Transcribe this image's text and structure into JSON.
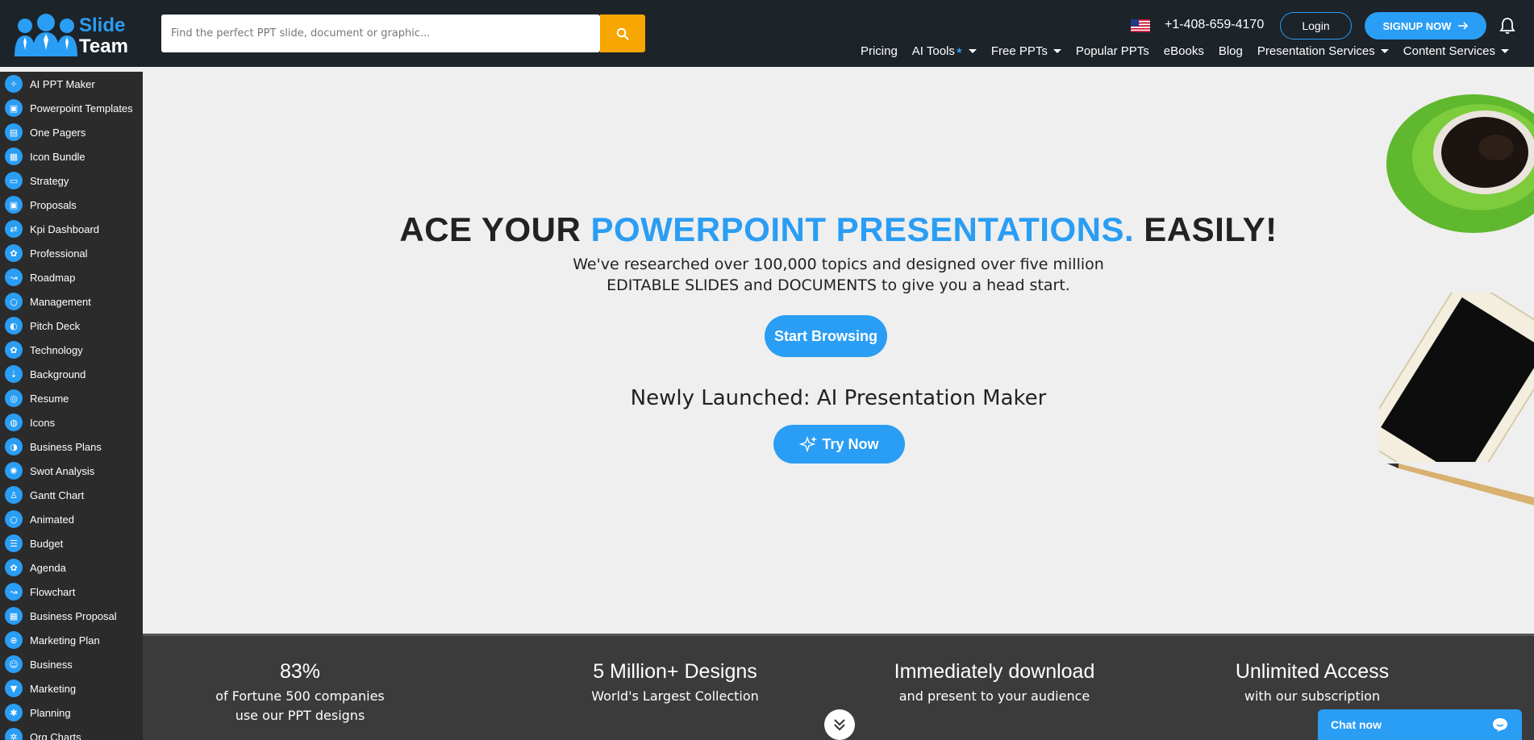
{
  "header": {
    "logo": {
      "line1": "Slide",
      "line2": "Team"
    },
    "search": {
      "placeholder": "Find the perfect PPT slide, document or graphic..."
    },
    "phone": "+1-408-659-4170",
    "login_label": "Login",
    "signup_label": "SIGNUP NOW",
    "nav": [
      {
        "label": "Pricing",
        "dropdown": false
      },
      {
        "label": "AI Tools",
        "dropdown": true,
        "star": true
      },
      {
        "label": "Free PPTs",
        "dropdown": true
      },
      {
        "label": "Popular PPTs",
        "dropdown": false
      },
      {
        "label": "eBooks",
        "dropdown": false
      },
      {
        "label": "Blog",
        "dropdown": false
      },
      {
        "label": "Presentation Services",
        "dropdown": true
      },
      {
        "label": "Content Services",
        "dropdown": true
      }
    ]
  },
  "sidebar": {
    "items": [
      {
        "label": "AI PPT Maker"
      },
      {
        "label": "Powerpoint Templates"
      },
      {
        "label": "One Pagers"
      },
      {
        "label": "Icon Bundle"
      },
      {
        "label": "Strategy"
      },
      {
        "label": "Proposals"
      },
      {
        "label": "Kpi Dashboard"
      },
      {
        "label": "Professional"
      },
      {
        "label": "Roadmap"
      },
      {
        "label": "Management"
      },
      {
        "label": "Pitch Deck"
      },
      {
        "label": "Technology"
      },
      {
        "label": "Background"
      },
      {
        "label": "Resume"
      },
      {
        "label": "Icons"
      },
      {
        "label": "Business Plans"
      },
      {
        "label": "Swot Analysis"
      },
      {
        "label": "Gantt Chart"
      },
      {
        "label": "Animated"
      },
      {
        "label": "Budget"
      },
      {
        "label": "Agenda"
      },
      {
        "label": "Flowchart"
      },
      {
        "label": "Business Proposal"
      },
      {
        "label": "Marketing Plan"
      },
      {
        "label": "Business"
      },
      {
        "label": "Marketing"
      },
      {
        "label": "Planning"
      },
      {
        "label": "Org Charts"
      }
    ]
  },
  "hero": {
    "headline_part1": "ACE YOUR ",
    "headline_accent": "POWERPOINT PRESENTATIONS.",
    "headline_part2": " EASILY!",
    "subline1": "We've researched over 100,000 topics and designed over five million",
    "subline2": "EDITABLE SLIDES and DOCUMENTS to give you a head start.",
    "browse_label": "Start Browsing",
    "newly_label": "Newly Launched: AI Presentation Maker",
    "try_label": "Try Now"
  },
  "stats": [
    {
      "big": "83%",
      "small1": "of Fortune 500 companies",
      "small2": "use our PPT designs"
    },
    {
      "big": "5 Million+ Designs",
      "small1": "World's Largest Collection",
      "small2": ""
    },
    {
      "big": "Immediately download",
      "small1": "and present to your audience",
      "small2": ""
    },
    {
      "big": "Unlimited Access",
      "small1": "with our subscription",
      "small2": ""
    }
  ],
  "chat": {
    "label": "Chat now"
  },
  "colors": {
    "accent": "#2a9df4",
    "header_bg": "#1c2329",
    "sidebar_bg": "#2b2b2b",
    "search_button": "#f7a500",
    "stats_bg": "#3b3b3b"
  }
}
